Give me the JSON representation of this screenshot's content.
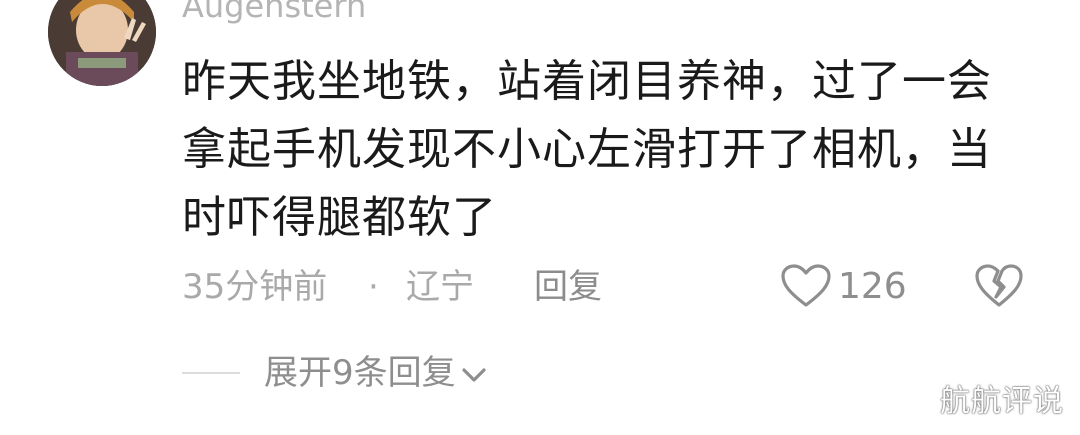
{
  "comment": {
    "username": "Augenstern",
    "text": "昨天我坐地铁，站着闭目养神，过了一会拿起手机发现不小心左滑打开了相机，当时吓得腿都软了",
    "time": "35分钟前",
    "separator": "·",
    "location": "辽宁",
    "reply_label": "回复",
    "like_count": "126",
    "like_icon": "heart-outline-icon",
    "dislike_icon": "broken-heart-icon"
  },
  "replies": {
    "expand_label": "展开9条回复"
  },
  "watermark": {
    "text": "航航评说"
  },
  "colors": {
    "text_primary": "#1a1a1a",
    "text_secondary": "#a9a9a9",
    "username": "#b4b4b4",
    "icon": "#8e8e8e"
  }
}
